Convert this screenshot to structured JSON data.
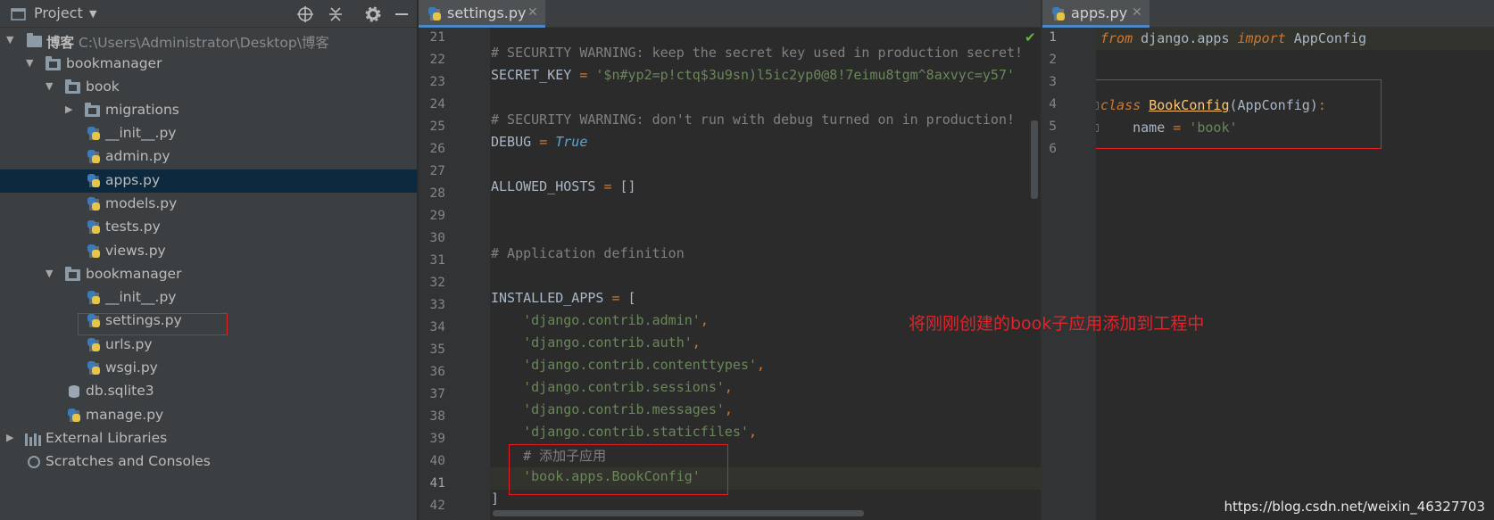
{
  "project_panel": {
    "title": "Project",
    "tree": [
      {
        "label": "博客",
        "path": "C:\\Users\\Administrator\\Desktop\\博客"
      },
      {
        "label": "bookmanager"
      },
      {
        "label": "book"
      },
      {
        "label": "migrations"
      },
      {
        "label": "__init__.py"
      },
      {
        "label": "admin.py"
      },
      {
        "label": "apps.py"
      },
      {
        "label": "models.py"
      },
      {
        "label": "tests.py"
      },
      {
        "label": "views.py"
      },
      {
        "label": "bookmanager"
      },
      {
        "label": "__init__.py"
      },
      {
        "label": "settings.py"
      },
      {
        "label": "urls.py"
      },
      {
        "label": "wsgi.py"
      },
      {
        "label": "db.sqlite3"
      },
      {
        "label": "manage.py"
      },
      {
        "label": "External Libraries"
      },
      {
        "label": "Scratches and Consoles"
      }
    ]
  },
  "left_editor": {
    "tab_label": "settings.py",
    "line_numbers": [
      "21",
      "22",
      "23",
      "24",
      "25",
      "26",
      "27",
      "28",
      "29",
      "30",
      "31",
      "32",
      "33",
      "34",
      "35",
      "36",
      "37",
      "38",
      "39",
      "40",
      "41",
      "42"
    ]
  },
  "right_editor": {
    "tab_label": "apps.py",
    "line_numbers": [
      "1",
      "2",
      "3",
      "4",
      "5",
      "6"
    ]
  },
  "annotation": "将刚刚创建的book子应用添加到工程中",
  "watermark": "https://blog.csdn.net/weixin_46327703",
  "colors": {
    "background": "#2b2b2b",
    "panel": "#3c3f41",
    "selection": "#0d293e",
    "highlight_box": "#e02020",
    "annotation": "#e0242a"
  }
}
